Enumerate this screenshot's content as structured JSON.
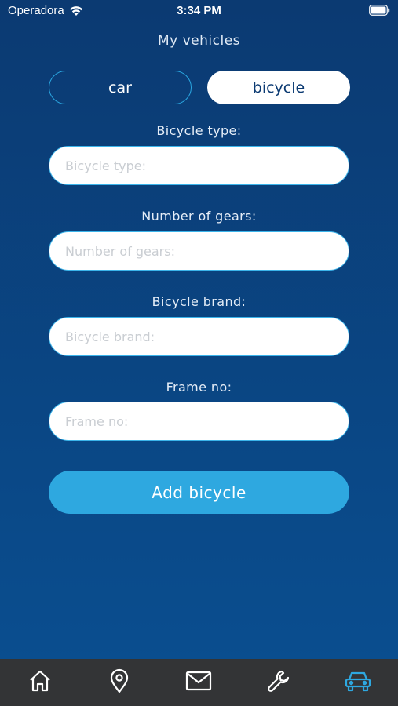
{
  "status_bar": {
    "carrier": "Operadora",
    "time": "3:34 PM"
  },
  "page": {
    "title": "My vehicles"
  },
  "vehicle_toggle": {
    "car_label": "car",
    "bicycle_label": "bicycle",
    "selected": "bicycle"
  },
  "form": {
    "bicycle_type": {
      "label": "Bicycle type:",
      "placeholder": "Bicycle type:",
      "value": ""
    },
    "gears": {
      "label": "Number of gears:",
      "placeholder": "Number of gears:",
      "value": ""
    },
    "brand": {
      "label": "Bicycle brand:",
      "placeholder": "Bicycle brand:",
      "value": ""
    },
    "frame": {
      "label": "Frame no:",
      "placeholder": "Frame no:",
      "value": ""
    },
    "submit_label": "Add bicycle"
  },
  "tab_bar": {
    "items": [
      {
        "icon": "home-icon",
        "active": false
      },
      {
        "icon": "location-pin-icon",
        "active": false
      },
      {
        "icon": "mail-icon",
        "active": false
      },
      {
        "icon": "wrench-icon",
        "active": false
      },
      {
        "icon": "car-icon",
        "active": true
      }
    ]
  },
  "colors": {
    "accent": "#2ea8e0",
    "tab_inactive": "#ffffff",
    "tab_active": "#2ea8e0",
    "bg_top": "#0b3a72",
    "bg_bottom": "#0a4f91"
  }
}
